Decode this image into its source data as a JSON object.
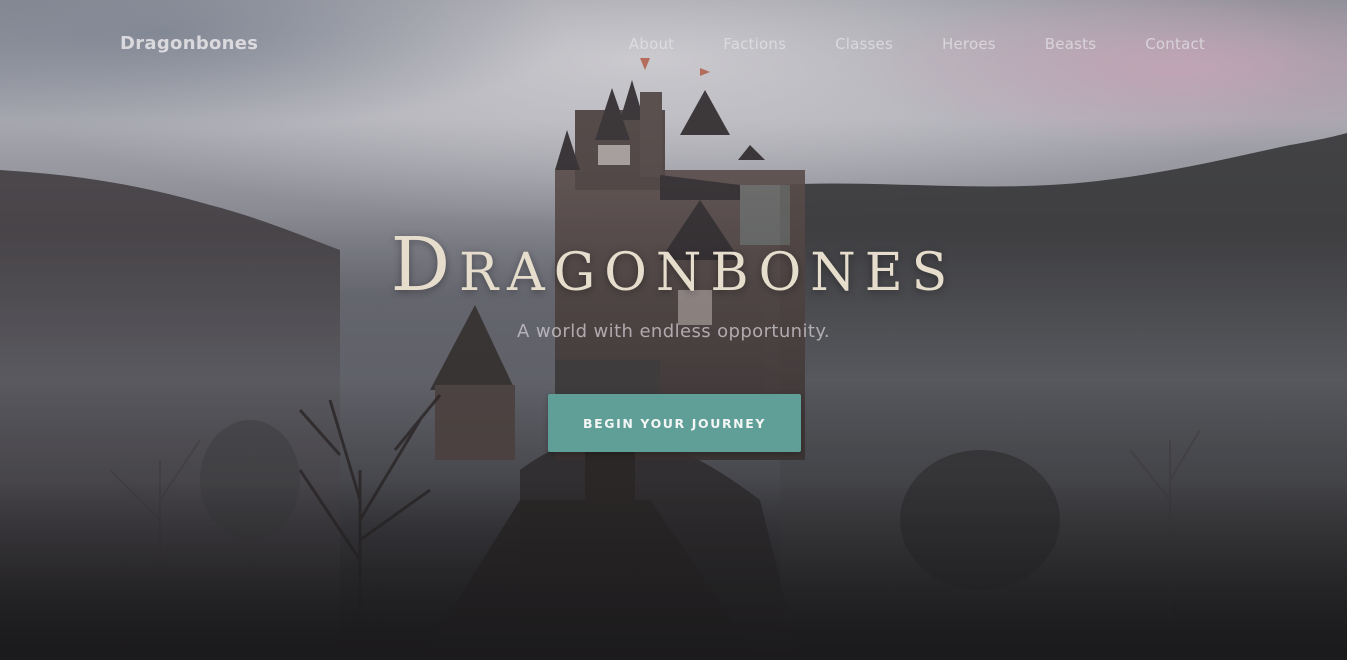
{
  "brand": {
    "name": "Dragonbones"
  },
  "nav": {
    "items": [
      {
        "label": "About"
      },
      {
        "label": "Factions"
      },
      {
        "label": "Classes"
      },
      {
        "label": "Heroes"
      },
      {
        "label": "Beasts"
      },
      {
        "label": "Contact"
      }
    ]
  },
  "hero": {
    "title": "Dragonbones",
    "subtitle": "A world with endless opportunity.",
    "cta_label": "Begin your journey"
  },
  "colors": {
    "accent": "#5f9f98",
    "title": "#e7ddcd",
    "background_dark": "#1b1a1c"
  }
}
